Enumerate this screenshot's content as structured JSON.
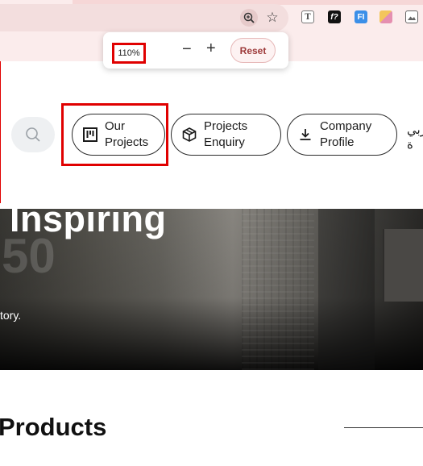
{
  "browser": {
    "zoom_popup": {
      "level": "110%",
      "minus": "−",
      "plus": "+",
      "reset": "Reset"
    },
    "icons": [
      "zoom-icon",
      "star-icon",
      "extension-t-icon",
      "extension-f-icon",
      "extension-fi-icon",
      "extension-pen-icon",
      "image-icon"
    ],
    "ext_f_label": "f?",
    "ext_fi_label": "FI",
    "ext_t_label": "T"
  },
  "header": {
    "nav": [
      {
        "line1": "Our",
        "line2": "Projects",
        "icon": "kanban-board-icon"
      },
      {
        "line1": "Projects",
        "line2": "Enquiry",
        "icon": "cube-icon"
      },
      {
        "line1": "Company",
        "line2": "Profile",
        "icon": "download-icon"
      }
    ],
    "language": {
      "line1": "عربي",
      "line2": "ة"
    }
  },
  "hero": {
    "title": "Inspiring",
    "ghost_text": "50",
    "subtitle": "tory."
  },
  "products": {
    "title": "Products"
  },
  "colors": {
    "highlight": "#e00000",
    "chrome_bg": "#fbecec",
    "reset_text": "#9d3a3a"
  }
}
